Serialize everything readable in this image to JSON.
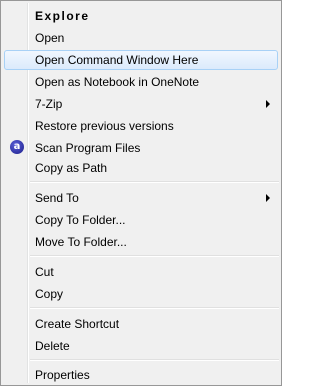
{
  "context_menu": {
    "items": [
      {
        "label": "Explore"
      },
      {
        "label": "Open"
      },
      {
        "label": "Open Command Window Here"
      },
      {
        "label": "Open as Notebook in OneNote"
      },
      {
        "label": "7-Zip"
      },
      {
        "label": "Restore previous versions"
      },
      {
        "label": "Scan Program Files"
      },
      {
        "label": "Copy as Path"
      },
      {
        "label": "Send To"
      },
      {
        "label": "Copy To Folder..."
      },
      {
        "label": "Move To Folder..."
      },
      {
        "label": "Cut"
      },
      {
        "label": "Copy"
      },
      {
        "label": "Create Shortcut"
      },
      {
        "label": "Delete"
      },
      {
        "label": "Properties"
      }
    ],
    "highlighted_item": "Open Command Window Here",
    "scan_icon": "antivirus-scan-icon",
    "submenu_arrow_icon": "submenu-arrow-icon",
    "colors": {
      "menu_background": "#f0f0f0",
      "highlight_border": "#a8d1f6",
      "highlight_fill": "#dbeafc",
      "scan_icon": "#2a2ea8"
    }
  }
}
